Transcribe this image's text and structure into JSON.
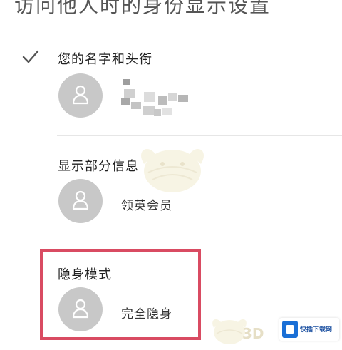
{
  "header": {
    "title": "访问他人时的身份显示设置"
  },
  "options": [
    {
      "label": "您的名字和头衔",
      "selected": true,
      "value": "",
      "avatar_icon": "user-avatar-icon"
    },
    {
      "label": "显示部分信息",
      "selected": false,
      "value": "领英会员",
      "avatar_icon": "user-avatar-icon"
    },
    {
      "label": "隐身模式",
      "selected": false,
      "value": "完全隐身",
      "avatar_icon": "user-avatar-icon",
      "highlighted": true
    }
  ],
  "watermark": {
    "text": "3D",
    "badge_text": "快插下载网"
  },
  "colors": {
    "highlight_border": "#d94b62",
    "avatar_background": "#c8c8c8",
    "check_color": "#555555",
    "badge_logo": "#1a6fd6"
  }
}
